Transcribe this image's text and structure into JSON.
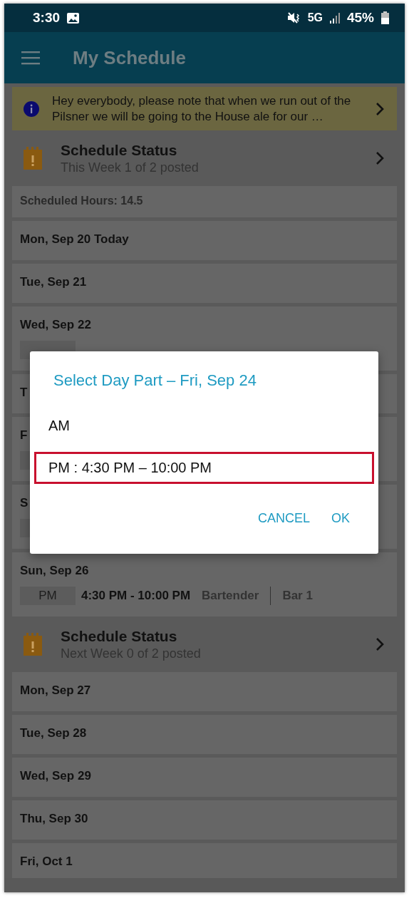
{
  "status_bar": {
    "time": "3:30",
    "network": "5G",
    "battery": "45%"
  },
  "app_bar": {
    "title": "My Schedule"
  },
  "announcement": {
    "text": "Hey everybody, please note that when we run out of the Pilsner we will be going to the House ale for our …"
  },
  "schedule": [
    {
      "kind": "status",
      "title": "Schedule Status",
      "subtitle": "This Week 1 of 2 posted"
    },
    {
      "kind": "hours",
      "text": "Scheduled Hours: 14.5"
    },
    {
      "kind": "day",
      "date": "Mon, Sep 20 Today"
    },
    {
      "kind": "day",
      "date": "Tue, Sep 21"
    },
    {
      "kind": "day",
      "date": "Wed, Sep 22",
      "shifts": [
        {
          "kind": "covered"
        }
      ]
    },
    {
      "kind": "day",
      "date": "T"
    },
    {
      "kind": "day",
      "date": "F",
      "shifts": [
        {
          "kind": "covered"
        }
      ]
    },
    {
      "kind": "day",
      "date": "S",
      "shifts": [
        {
          "kind": "covered"
        }
      ]
    },
    {
      "kind": "day",
      "date": "Sun, Sep 26",
      "shifts": [
        {
          "kind": "assigned",
          "part": "PM",
          "time": "4:30 PM - 10:00 PM",
          "role": "Bartender",
          "location": "Bar 1"
        }
      ]
    },
    {
      "kind": "status",
      "title": "Schedule Status",
      "subtitle": "Next Week 0 of 2 posted"
    },
    {
      "kind": "day",
      "date": "Mon, Sep 27"
    },
    {
      "kind": "day",
      "date": "Tue, Sep 28"
    },
    {
      "kind": "day",
      "date": "Wed, Sep 29"
    },
    {
      "kind": "day",
      "date": "Thu, Sep 30"
    },
    {
      "kind": "day",
      "date": "Fri, Oct 1"
    }
  ],
  "dialog": {
    "title": "Select Day Part – Fri, Sep 24",
    "options": [
      {
        "label": "AM",
        "selected": false
      },
      {
        "label": "PM : 4:30 PM – 10:00 PM",
        "selected": true
      }
    ],
    "buttons": [
      "CANCEL",
      "OK"
    ]
  }
}
